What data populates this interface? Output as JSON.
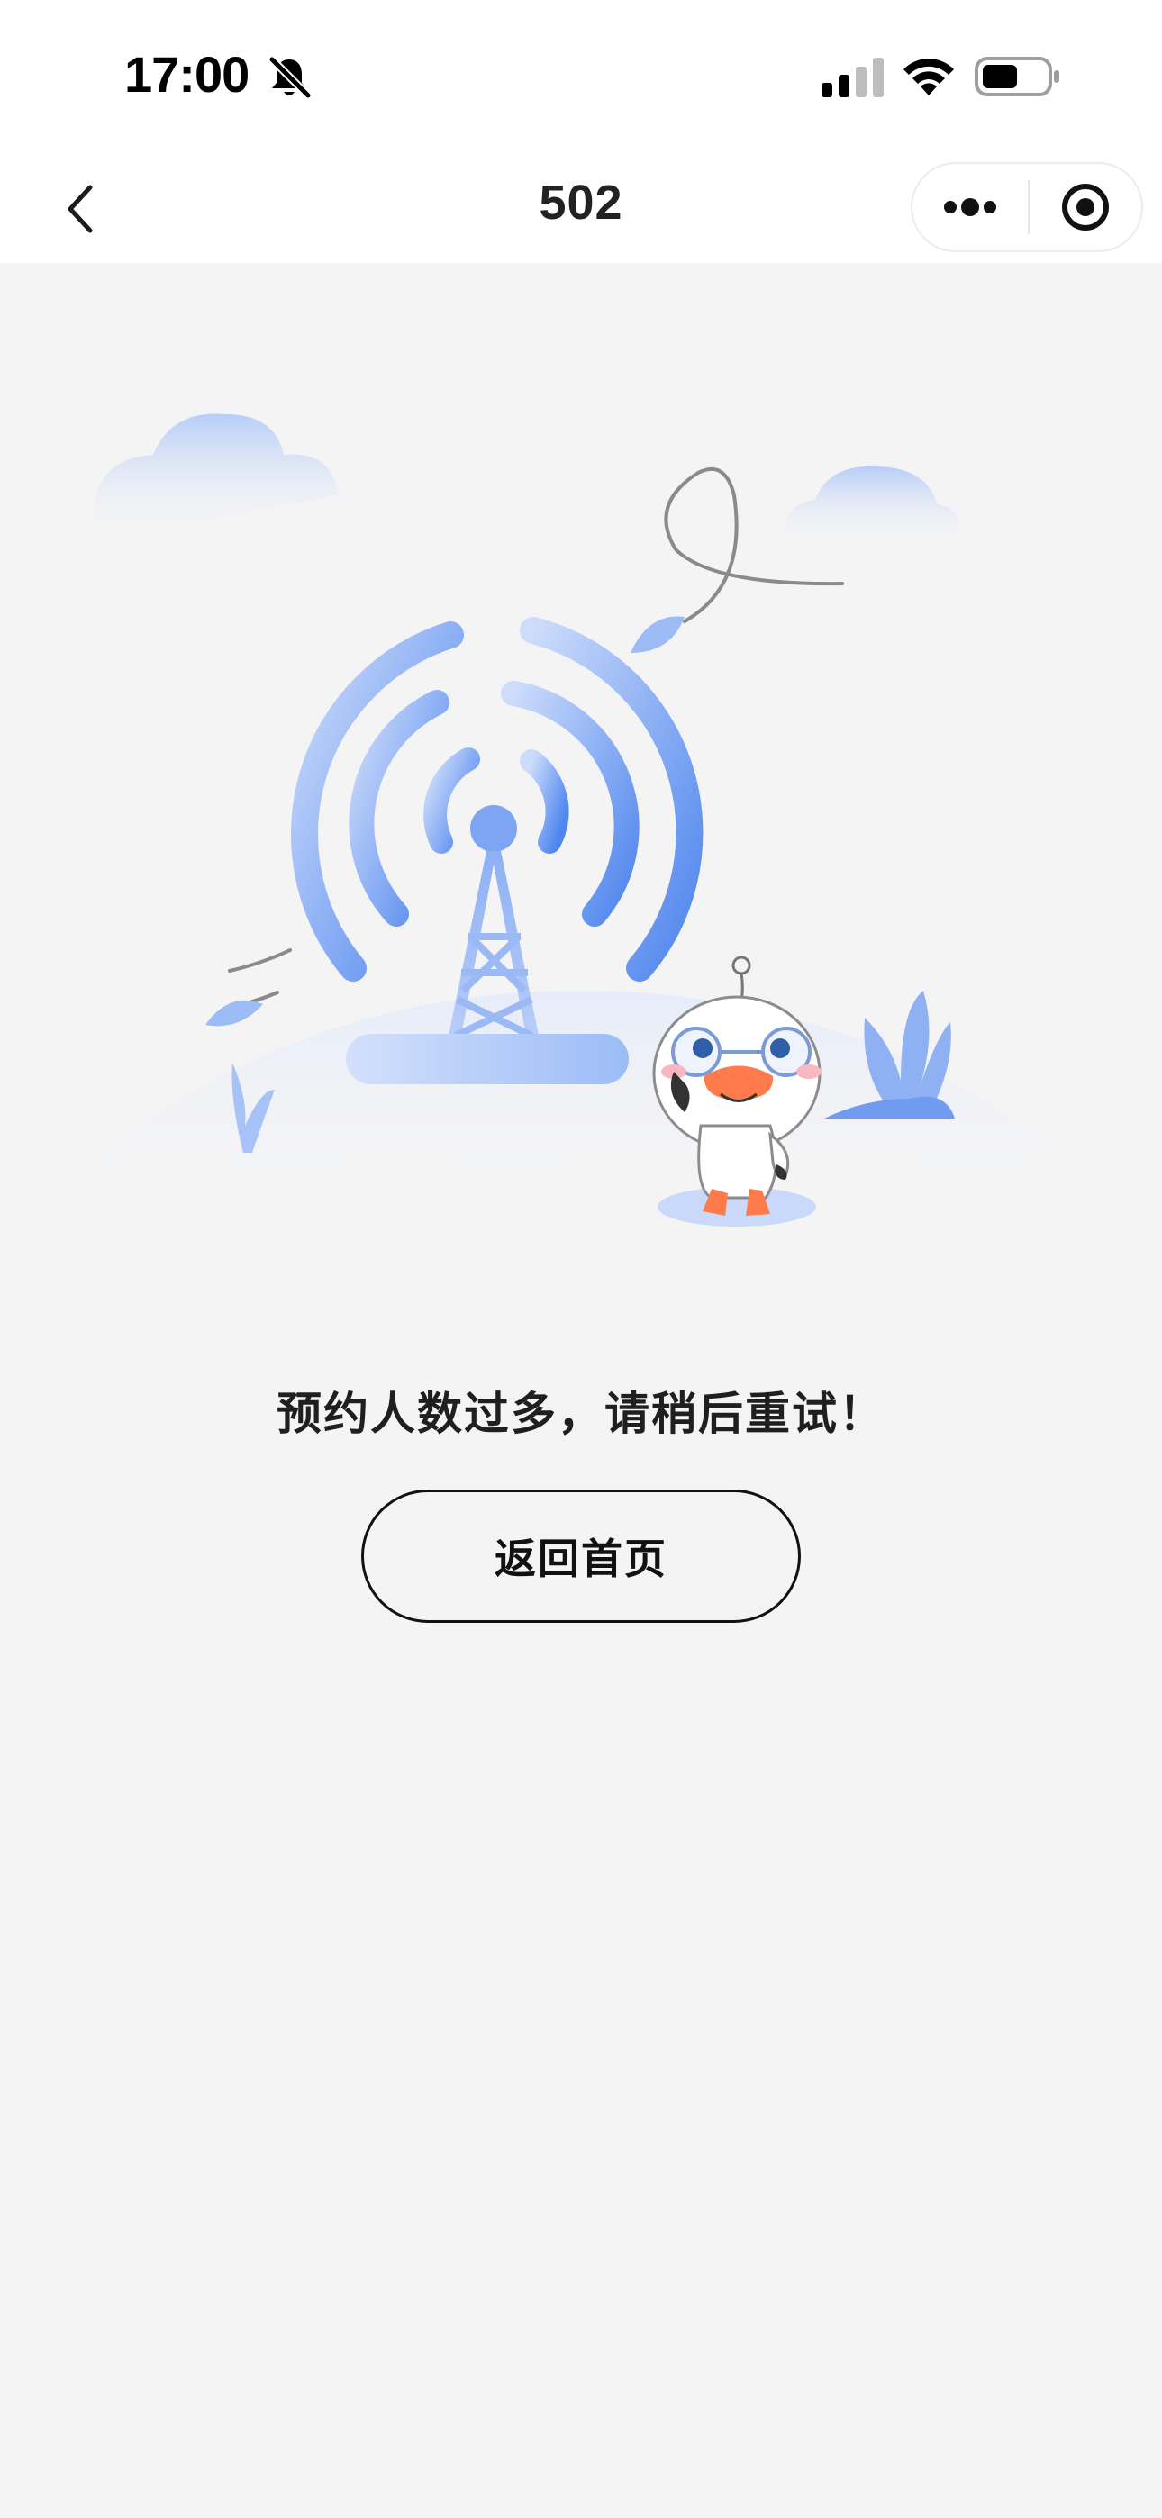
{
  "status_bar": {
    "time": "17:00",
    "icons": [
      "bell-slash-icon",
      "cellular-signal-icon",
      "wifi-icon",
      "battery-icon"
    ]
  },
  "nav": {
    "back_icon": "chevron-left-icon",
    "title": "502",
    "more_icon": "more-dots-icon",
    "close_icon": "target-close-icon"
  },
  "illustration": {
    "subject": "signal-tower-with-duck-mascot",
    "accent_color": "#5b8ef0"
  },
  "error": {
    "message": "预约人数过多，请稍后重试！"
  },
  "actions": {
    "home_label": "返回首页"
  }
}
